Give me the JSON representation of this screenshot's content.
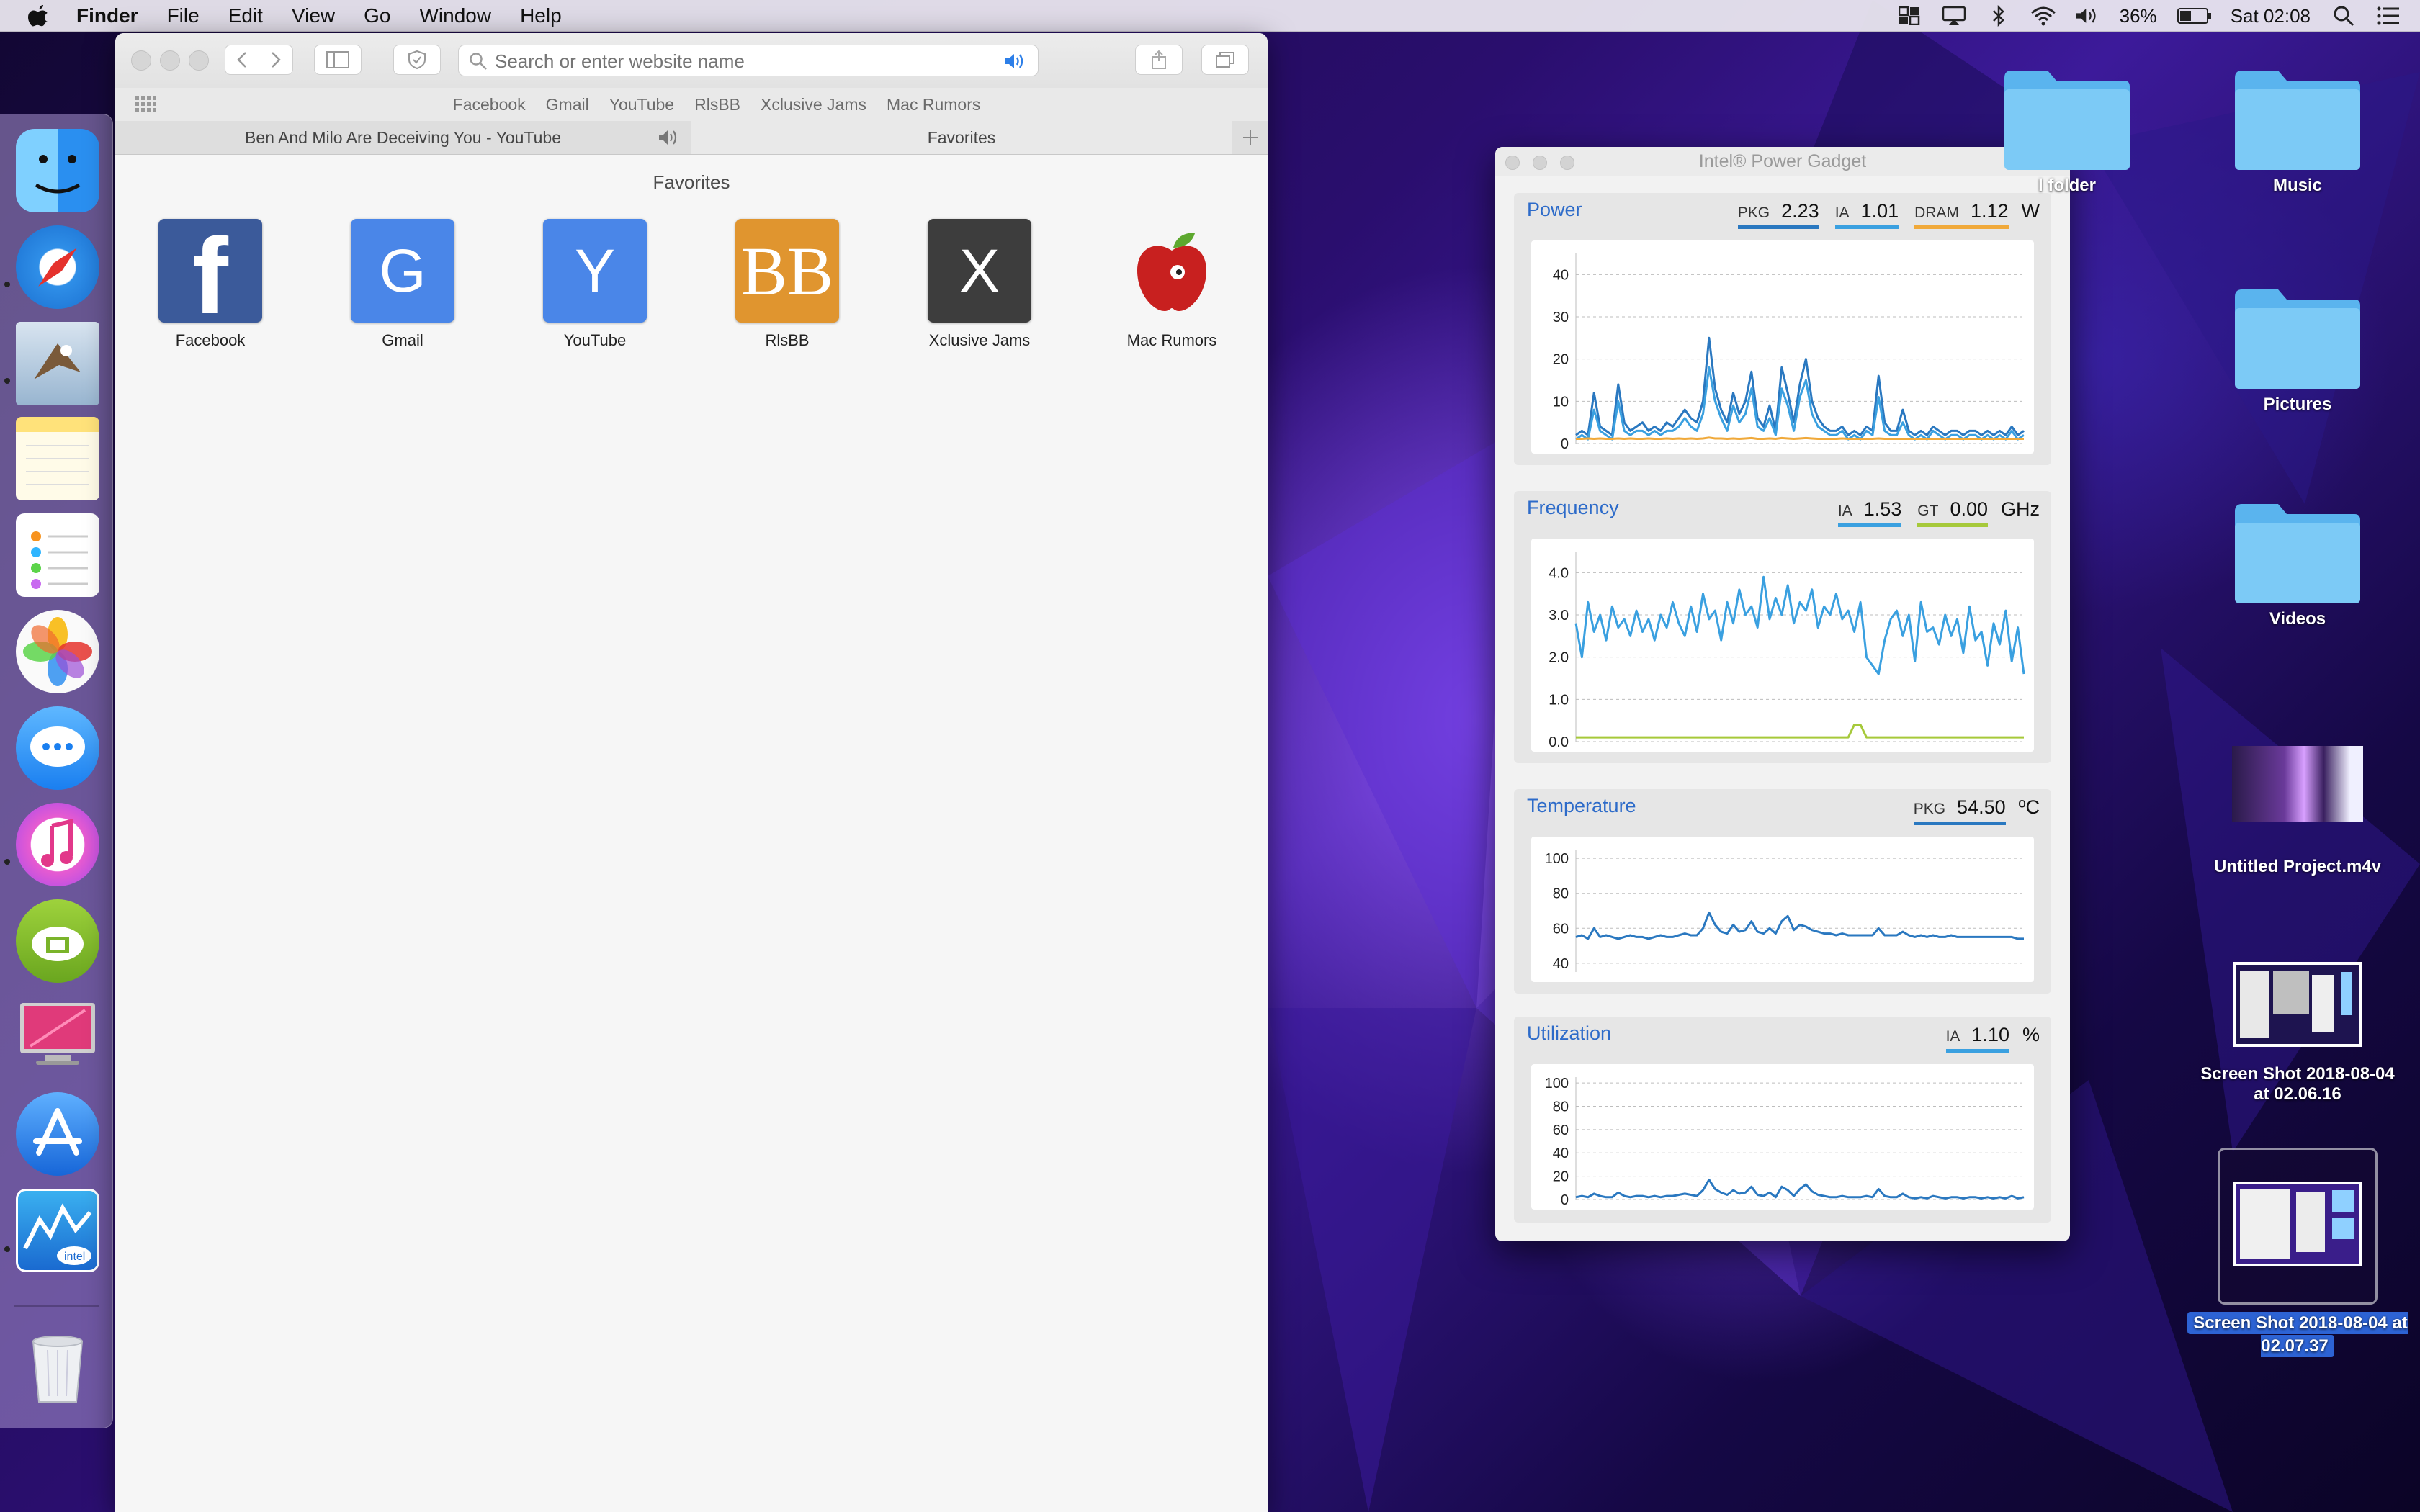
{
  "menubar": {
    "app_name": "Finder",
    "menus": [
      "File",
      "Edit",
      "View",
      "Go",
      "Window",
      "Help"
    ],
    "battery": "36%",
    "clock": "Sat 02:08"
  },
  "safari": {
    "address_placeholder": "Search or enter website name",
    "bookmarks": [
      "Facebook",
      "Gmail",
      "YouTube",
      "RlsBB",
      "Xclusive Jams",
      "Mac Rumors"
    ],
    "tabs": [
      "Ben And Milo Are Deceiving You - YouTube",
      "Favorites"
    ],
    "favorites_title": "Favorites",
    "favorites": [
      {
        "label": "Facebook",
        "glyph": "f",
        "color": "#3b5a9a"
      },
      {
        "label": "Gmail",
        "glyph": "G",
        "color": "#4a86e8"
      },
      {
        "label": "YouTube",
        "glyph": "Y",
        "color": "#4a86e8"
      },
      {
        "label": "RlsBB",
        "glyph": "BB",
        "color": "#e0952f"
      },
      {
        "label": "Xclusive Jams",
        "glyph": "X",
        "color": "#3d3d3d"
      },
      {
        "label": "Mac Rumors",
        "glyph": "",
        "color": "#f6f6f6"
      }
    ]
  },
  "power_gadget": {
    "title": "Intel® Power Gadget",
    "colors": {
      "blue": "#3aa0e0",
      "dark_blue": "#2a78c0",
      "orange": "#f0a93a",
      "green": "#a6c93a"
    },
    "power": {
      "title": "Power",
      "readouts": [
        {
          "key": "PKG",
          "value": "2.23",
          "color": "#2a78c0"
        },
        {
          "key": "IA",
          "value": "1.01",
          "color": "#3aa0e0"
        },
        {
          "key": "DRAM",
          "value": "1.12",
          "color": "#f0a93a"
        }
      ],
      "unit": "W",
      "yticks": [
        "40",
        "30",
        "20",
        "10",
        "0"
      ],
      "ylim": [
        0,
        45
      ]
    },
    "frequency": {
      "title": "Frequency",
      "readouts": [
        {
          "key": "IA",
          "value": "1.53",
          "color": "#3aa0e0"
        },
        {
          "key": "GT",
          "value": "0.00",
          "color": "#a6c93a"
        }
      ],
      "unit": "GHz",
      "yticks": [
        "4.0",
        "3.0",
        "2.0",
        "1.0",
        "0.0"
      ],
      "ylim": [
        0,
        4.5
      ]
    },
    "temperature": {
      "title": "Temperature",
      "readouts": [
        {
          "key": "PKG",
          "value": "54.50",
          "color": "#2a78c0"
        }
      ],
      "unit": "ºC",
      "yticks": [
        "100",
        "80",
        "60",
        "40"
      ],
      "ylim": [
        35,
        105
      ]
    },
    "utilization": {
      "title": "Utilization",
      "readouts": [
        {
          "key": "IA",
          "value": "1.10",
          "color": "#3aa0e0"
        }
      ],
      "unit": "%",
      "yticks": [
        "100",
        "80",
        "60",
        "40",
        "20",
        "0"
      ],
      "ylim": [
        0,
        105
      ]
    }
  },
  "chart_data": [
    {
      "type": "line",
      "ylim": [
        0,
        45
      ],
      "series": [
        {
          "values": [
            2,
            3,
            2,
            12,
            4,
            3,
            2,
            14,
            5,
            3,
            4,
            5,
            3,
            4,
            3,
            5,
            4,
            6,
            8,
            6,
            5,
            10,
            25,
            13,
            8,
            5,
            12,
            7,
            10,
            17,
            6,
            4,
            9,
            3,
            18,
            12,
            5,
            14,
            20,
            10,
            6,
            4,
            3,
            3,
            4,
            2,
            3,
            2,
            4,
            3,
            16,
            5,
            3,
            3,
            8,
            3,
            2,
            3,
            2,
            4,
            3,
            2,
            3,
            3,
            2,
            3,
            3,
            2,
            3,
            2,
            3,
            2,
            4,
            2,
            3
          ]
        },
        {
          "values": [
            1,
            2,
            1,
            8,
            3,
            2,
            1,
            10,
            3,
            2,
            3,
            3,
            2,
            3,
            2,
            3,
            3,
            4,
            6,
            4,
            3,
            7,
            18,
            10,
            6,
            3,
            9,
            5,
            7,
            13,
            4,
            3,
            6,
            2,
            13,
            9,
            3,
            11,
            15,
            7,
            4,
            3,
            2,
            2,
            3,
            1,
            2,
            1,
            3,
            2,
            11,
            3,
            2,
            2,
            5,
            2,
            1,
            2,
            1,
            3,
            2,
            1,
            2,
            2,
            1,
            2,
            2,
            1,
            2,
            1,
            2,
            1,
            3,
            1,
            2
          ]
        },
        {
          "values": [
            1.1,
            1.1,
            1.2,
            1.1,
            1.2,
            1.1,
            1.1,
            1.2,
            1.1,
            1.2,
            1.1,
            1.1,
            1.2,
            1.1,
            1.1,
            1.2,
            1.1,
            1.2,
            1.1,
            1.2,
            1.1,
            1.2,
            1.4,
            1.2,
            1.2,
            1.1,
            1.2,
            1.1,
            1.2,
            1.3,
            1.1,
            1.1,
            1.2,
            1.1,
            1.3,
            1.2,
            1.1,
            1.2,
            1.3,
            1.2,
            1.1,
            1.1,
            1.1,
            1.1,
            1.2,
            1.1,
            1.1,
            1.1,
            1.1,
            1.1,
            1.2,
            1.1,
            1.1,
            1.1,
            1.1,
            1.1,
            1.1,
            1.1,
            1.1,
            1.1,
            1.1,
            1.1,
            1.1,
            1.1,
            1.1,
            1.1,
            1.1,
            1.1,
            1.1,
            1.1,
            1.1,
            1.1,
            1.1,
            1.1,
            1.1
          ]
        }
      ]
    },
    {
      "type": "line",
      "ylim": [
        0,
        4.5
      ],
      "series": [
        {
          "values": [
            2.8,
            2.0,
            3.3,
            2.6,
            3.0,
            2.4,
            3.2,
            2.7,
            2.9,
            2.5,
            3.1,
            2.6,
            2.9,
            2.4,
            3.0,
            2.7,
            3.3,
            2.8,
            2.5,
            3.2,
            2.6,
            3.5,
            2.9,
            3.1,
            2.4,
            3.3,
            2.8,
            3.6,
            3.0,
            3.2,
            2.7,
            3.9,
            2.9,
            3.4,
            3.0,
            3.7,
            2.8,
            3.3,
            3.1,
            3.6,
            2.7,
            3.2,
            3.0,
            3.5,
            2.9,
            3.1,
            2.6,
            3.3,
            2.0,
            1.8,
            1.6,
            2.4,
            2.9,
            3.1,
            2.5,
            3.0,
            1.9,
            3.3,
            2.6,
            2.7,
            2.3,
            3.0,
            2.5,
            2.9,
            2.1,
            3.2,
            2.4,
            2.6,
            1.8,
            2.8,
            2.3,
            3.1,
            1.9,
            2.7,
            1.6
          ]
        },
        {
          "values": [
            0.1,
            0.1,
            0.1,
            0.1,
            0.1,
            0.1,
            0.1,
            0.1,
            0.1,
            0.1,
            0.1,
            0.1,
            0.1,
            0.1,
            0.1,
            0.1,
            0.1,
            0.1,
            0.1,
            0.1,
            0.1,
            0.1,
            0.1,
            0.1,
            0.1,
            0.1,
            0.1,
            0.1,
            0.1,
            0.1,
            0.1,
            0.1,
            0.1,
            0.1,
            0.1,
            0.1,
            0.1,
            0.1,
            0.1,
            0.1,
            0.1,
            0.1,
            0.1,
            0.1,
            0.1,
            0.1,
            0.4,
            0.4,
            0.1,
            0.1,
            0.1,
            0.1,
            0.1,
            0.1,
            0.1,
            0.1,
            0.1,
            0.1,
            0.1,
            0.1,
            0.1,
            0.1,
            0.1,
            0.1,
            0.1,
            0.1,
            0.1,
            0.1,
            0.1,
            0.1,
            0.1,
            0.1,
            0.1,
            0.1,
            0.1
          ]
        }
      ]
    },
    {
      "type": "line",
      "ylim": [
        35,
        105
      ],
      "series": [
        {
          "values": [
            55,
            56,
            54,
            60,
            55,
            56,
            55,
            54,
            55,
            56,
            55,
            55,
            54,
            55,
            56,
            55,
            55,
            56,
            57,
            56,
            56,
            60,
            69,
            62,
            58,
            57,
            62,
            58,
            59,
            64,
            58,
            57,
            60,
            57,
            64,
            67,
            59,
            62,
            61,
            59,
            58,
            57,
            57,
            56,
            57,
            56,
            56,
            56,
            56,
            56,
            60,
            56,
            56,
            56,
            58,
            56,
            55,
            56,
            55,
            56,
            55,
            55,
            56,
            55,
            55,
            55,
            55,
            55,
            55,
            55,
            55,
            55,
            55,
            54,
            54
          ]
        }
      ]
    },
    {
      "type": "line",
      "ylim": [
        0,
        105
      ],
      "series": [
        {
          "values": [
            2,
            3,
            2,
            5,
            3,
            2,
            2,
            6,
            3,
            2,
            3,
            3,
            2,
            3,
            2,
            3,
            3,
            4,
            5,
            4,
            3,
            8,
            17,
            9,
            6,
            4,
            8,
            5,
            6,
            11,
            4,
            3,
            6,
            2,
            11,
            8,
            3,
            9,
            13,
            7,
            4,
            3,
            2,
            2,
            3,
            2,
            2,
            2,
            3,
            2,
            9,
            3,
            2,
            2,
            5,
            2,
            1,
            2,
            1,
            3,
            2,
            1,
            2,
            2,
            1,
            2,
            2,
            1,
            2,
            1,
            2,
            1,
            3,
            1,
            2
          ]
        }
      ]
    }
  ],
  "desktop_icons": [
    {
      "label": "l folder",
      "kind": "folder"
    },
    {
      "label": "Music",
      "kind": "folder"
    },
    {
      "label": "Pictures",
      "kind": "folder"
    },
    {
      "label": "Videos",
      "kind": "folder"
    },
    {
      "label": "Untitled Project.m4v",
      "kind": "video"
    },
    {
      "label": "Screen Shot 2018-08-04 at 02.06.16",
      "kind": "screenshot"
    },
    {
      "label": "Screen Shot 2018-08-04 at 02.07.37",
      "kind": "screenshot-selected"
    }
  ]
}
